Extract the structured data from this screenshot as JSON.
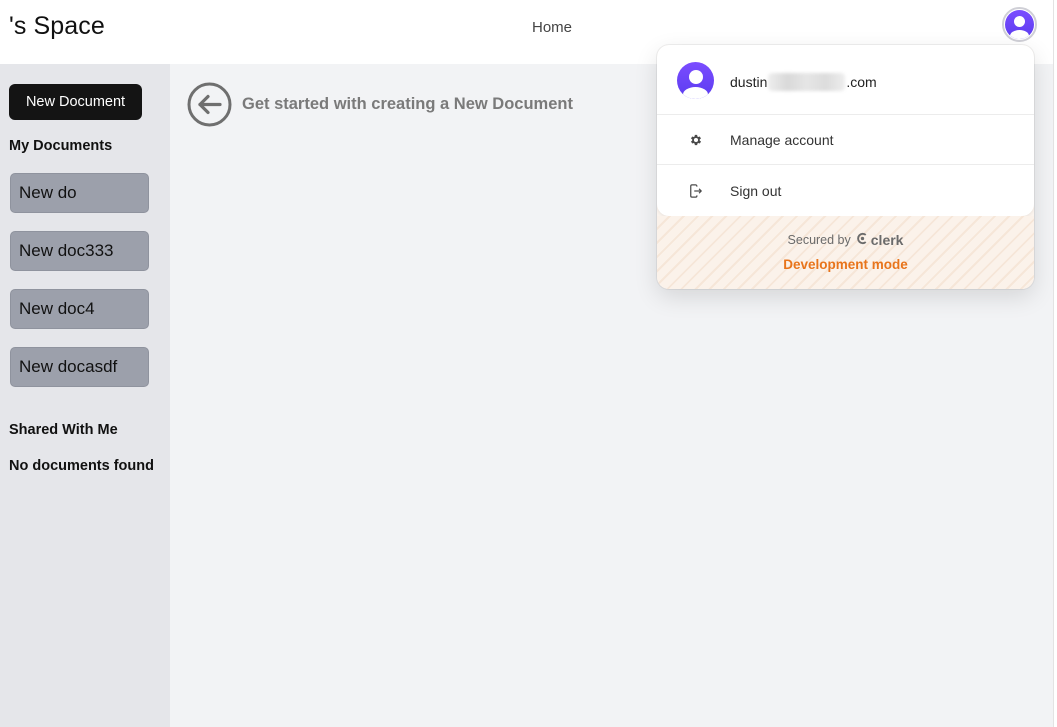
{
  "header": {
    "space_title": "'s Space",
    "home_link": "Home"
  },
  "sidebar": {
    "new_document_button": "New Document",
    "my_documents_heading": "My Documents",
    "documents": [
      {
        "label": "New do"
      },
      {
        "label": "New doc333"
      },
      {
        "label": "New doc4"
      },
      {
        "label": "New docasdf"
      }
    ],
    "shared_heading": "Shared With Me",
    "shared_empty": "No documents found"
  },
  "main": {
    "prompt": "Get started with creating a New Document",
    "back_icon": "arrow-left-circle-icon"
  },
  "account_menu": {
    "email_prefix": "dustin",
    "email_suffix": ".com",
    "items": [
      {
        "label": "Manage account",
        "icon": "gear-icon"
      },
      {
        "label": "Sign out",
        "icon": "sign-out-icon"
      }
    ],
    "secured_by": "Secured by",
    "brand": "clerk",
    "dev_mode": "Development mode"
  },
  "colors": {
    "accent": "#6c47ff",
    "dev_mode": "#e8741b",
    "sidebar_bg": "#e5e6ea",
    "doc_item_bg": "#9ca0ab",
    "main_bg": "#f2f3f5"
  }
}
